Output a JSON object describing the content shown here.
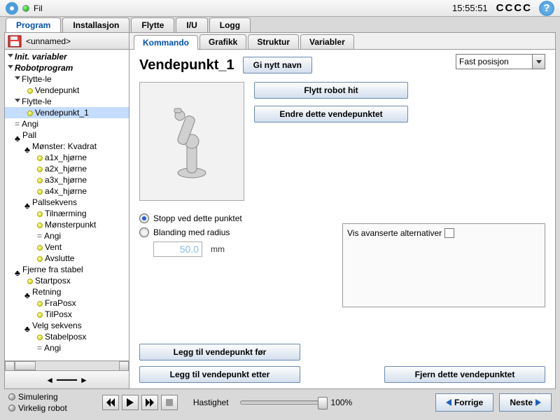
{
  "topbar": {
    "menu_fil": "Fil",
    "clock": "15:55:51",
    "cccc": "CCCC"
  },
  "main_tabs": [
    "Program",
    "Installasjon",
    "Flytte",
    "I/U",
    "Logg"
  ],
  "main_tabs_active": 0,
  "filename": "<unnamed>",
  "tree": {
    "init_vars": "Init. variabler",
    "robotprogram": "Robotprogram",
    "move1": "Flytte-le",
    "wp0": "Vendepunkt",
    "move2": "Flytte-le",
    "wp1": "Vendepunkt_1",
    "sett": "Angi",
    "pall": "Pall",
    "pattern": "Mønster: Kvadrat",
    "c1": "a1x_hjørne",
    "c2": "a2x_hjørne",
    "c3": "a3x_hjørne",
    "c4": "a4x_hjørne",
    "pallseq": "Pallsekvens",
    "approach": "Tilnærming",
    "patternpt": "Mønsterpunkt",
    "sett2": "Angi",
    "wait": "Vent",
    "exit": "Avslutte",
    "depallet": "Fjerne fra stabel",
    "startposx": "Startposx",
    "direction": "Retning",
    "fraposx": "FraPosx",
    "tilposx": "TilPosx",
    "stackseq": "Velg sekvens",
    "stabelposx": "Stabelposx",
    "sett3": "Angi"
  },
  "sub_tabs": [
    "Kommando",
    "Grafikk",
    "Struktur",
    "Variabler"
  ],
  "sub_tabs_active": 0,
  "content": {
    "title": "Vendepunkt_1",
    "rename_btn": "Gi nytt navn",
    "combo_value": "Fast posisjon",
    "move_here_btn": "Flytt robot hit",
    "change_wp_btn": "Endre dette vendepunktet",
    "adv_label": "Vis avanserte alternativer",
    "stop_label": "Stopp ved dette punktet",
    "blend_label": "Blanding med radius",
    "radius_value": "50.0",
    "radius_unit": "mm",
    "add_before": "Legg til vendepunkt før",
    "add_after": "Legg til vendepunkt etter",
    "remove_wp": "Fjern dette vendepunktet"
  },
  "footer": {
    "sim": "Simulering",
    "real": "Virkelig robot",
    "speed_label": "Hastighet",
    "speed_value": "100%",
    "prev": "Forrige",
    "next": "Neste"
  }
}
